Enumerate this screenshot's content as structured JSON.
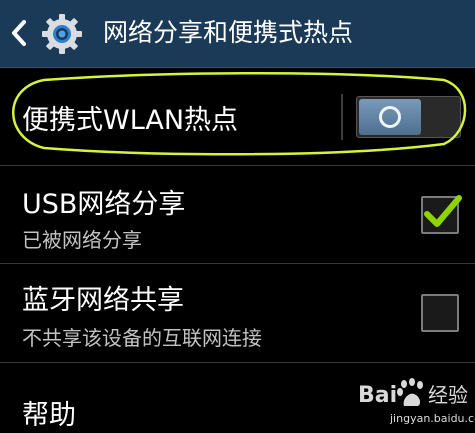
{
  "header": {
    "title": "网络分享和便携式热点",
    "back_icon": "chevron-left-icon",
    "settings_icon": "gear-icon"
  },
  "items": [
    {
      "label": "便携式WLAN热点",
      "control": "toggle",
      "state": "off"
    },
    {
      "label": "USB网络分享",
      "subtitle": "已被网络分享",
      "control": "checkbox",
      "checked": true
    },
    {
      "label": "蓝牙网络共享",
      "subtitle": "不共享该设备的互联网连接",
      "control": "checkbox",
      "checked": false
    },
    {
      "label": "帮助"
    }
  ],
  "watermark": {
    "logo_text": "Bai 经验",
    "url": "jingyan.baidu.com"
  },
  "colors": {
    "header_bg": "#1b3a57",
    "background": "#000000",
    "check_green": "#8ed400",
    "highlight_stroke": "#d7f23c",
    "toggle_knob": "#5e82a4"
  }
}
